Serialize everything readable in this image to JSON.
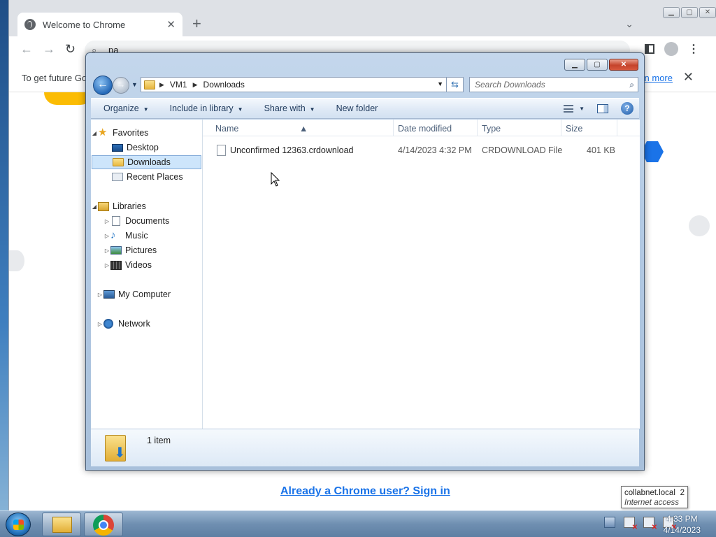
{
  "chrome": {
    "tab_title": "Welcome to Chrome",
    "tab_close": "✕",
    "new_tab": "+",
    "omnibox_text": "pa",
    "infobar_text": "To get future Go",
    "infobar_link": "rn more",
    "infobar_close": "✕",
    "signin_link": "Already a Chrome user? Sign in"
  },
  "explorer": {
    "breadcrumb": [
      "VM1",
      "Downloads"
    ],
    "search_placeholder": "Search Downloads",
    "commands": {
      "organize": "Organize",
      "include_in_library": "Include in library",
      "share_with": "Share with",
      "new_folder": "New folder"
    },
    "nav": {
      "favorites": "Favorites",
      "desktop": "Desktop",
      "downloads": "Downloads",
      "recent_places": "Recent Places",
      "libraries": "Libraries",
      "documents": "Documents",
      "music": "Music",
      "pictures": "Pictures",
      "videos": "Videos",
      "my_computer": "My Computer",
      "network": "Network"
    },
    "columns": {
      "name": "Name",
      "date_modified": "Date modified",
      "type": "Type",
      "size": "Size"
    },
    "files": [
      {
        "name": "Unconfirmed 12363.crdownload",
        "date_modified": "4/14/2023 4:32 PM",
        "type": "CRDOWNLOAD File",
        "size": "401 KB"
      }
    ],
    "item_count": "1 item"
  },
  "taskbar": {
    "time": "4:33 PM",
    "date": "4/14/2023"
  },
  "tooltip": {
    "network_name": "collabnet.local",
    "network_num": "2",
    "status": "Internet access"
  },
  "colors": {
    "chrome_link": "#1a73e8",
    "selection": "#cde5fb",
    "close_button": "#c6442c"
  }
}
